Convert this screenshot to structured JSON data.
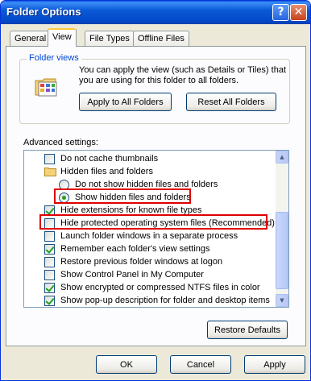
{
  "window": {
    "title": "Folder Options",
    "help_label": "?",
    "close_label": "✕"
  },
  "tabs": [
    {
      "label": "General",
      "active": false
    },
    {
      "label": "View",
      "active": true
    },
    {
      "label": "File Types",
      "active": false
    },
    {
      "label": "Offline Files",
      "active": false
    }
  ],
  "folder_views": {
    "legend": "Folder views",
    "description": "You can apply the view (such as Details or Tiles) that you are using for this folder to all folders.",
    "apply_label": "Apply to All Folders",
    "reset_label": "Reset All Folders"
  },
  "advanced": {
    "label": "Advanced settings:",
    "items": [
      {
        "type": "checkbox",
        "label": "Do not cache thumbnails",
        "checked": false,
        "indent": 0
      },
      {
        "type": "folder",
        "label": "Hidden files and folders",
        "indent": 0
      },
      {
        "type": "radio",
        "label": "Do not show hidden files and folders",
        "checked": false,
        "indent": 1
      },
      {
        "type": "radio",
        "label": "Show hidden files and folders",
        "checked": true,
        "indent": 1
      },
      {
        "type": "checkbox",
        "label": "Hide extensions for known file types",
        "checked": true,
        "indent": 0
      },
      {
        "type": "checkbox",
        "label": "Hide protected operating system files (Recommended)",
        "checked": false,
        "indent": 0
      },
      {
        "type": "checkbox",
        "label": "Launch folder windows in a separate process",
        "checked": false,
        "indent": 0
      },
      {
        "type": "checkbox",
        "label": "Remember each folder's view settings",
        "checked": true,
        "indent": 0
      },
      {
        "type": "checkbox",
        "label": "Restore previous folder windows at logon",
        "checked": false,
        "indent": 0
      },
      {
        "type": "checkbox",
        "label": "Show Control Panel in My Computer",
        "checked": false,
        "indent": 0
      },
      {
        "type": "checkbox",
        "label": "Show encrypted or compressed NTFS files in color",
        "checked": true,
        "indent": 0
      },
      {
        "type": "checkbox",
        "label": "Show pop-up description for folder and desktop items",
        "checked": true,
        "indent": 0
      }
    ],
    "restore_defaults_label": "Restore Defaults"
  },
  "footer": {
    "ok_label": "OK",
    "cancel_label": "Cancel",
    "apply_label": "Apply"
  },
  "colors": {
    "titlebar": "#0a5ad6",
    "highlight": "#e00000",
    "check": "#21a121"
  }
}
